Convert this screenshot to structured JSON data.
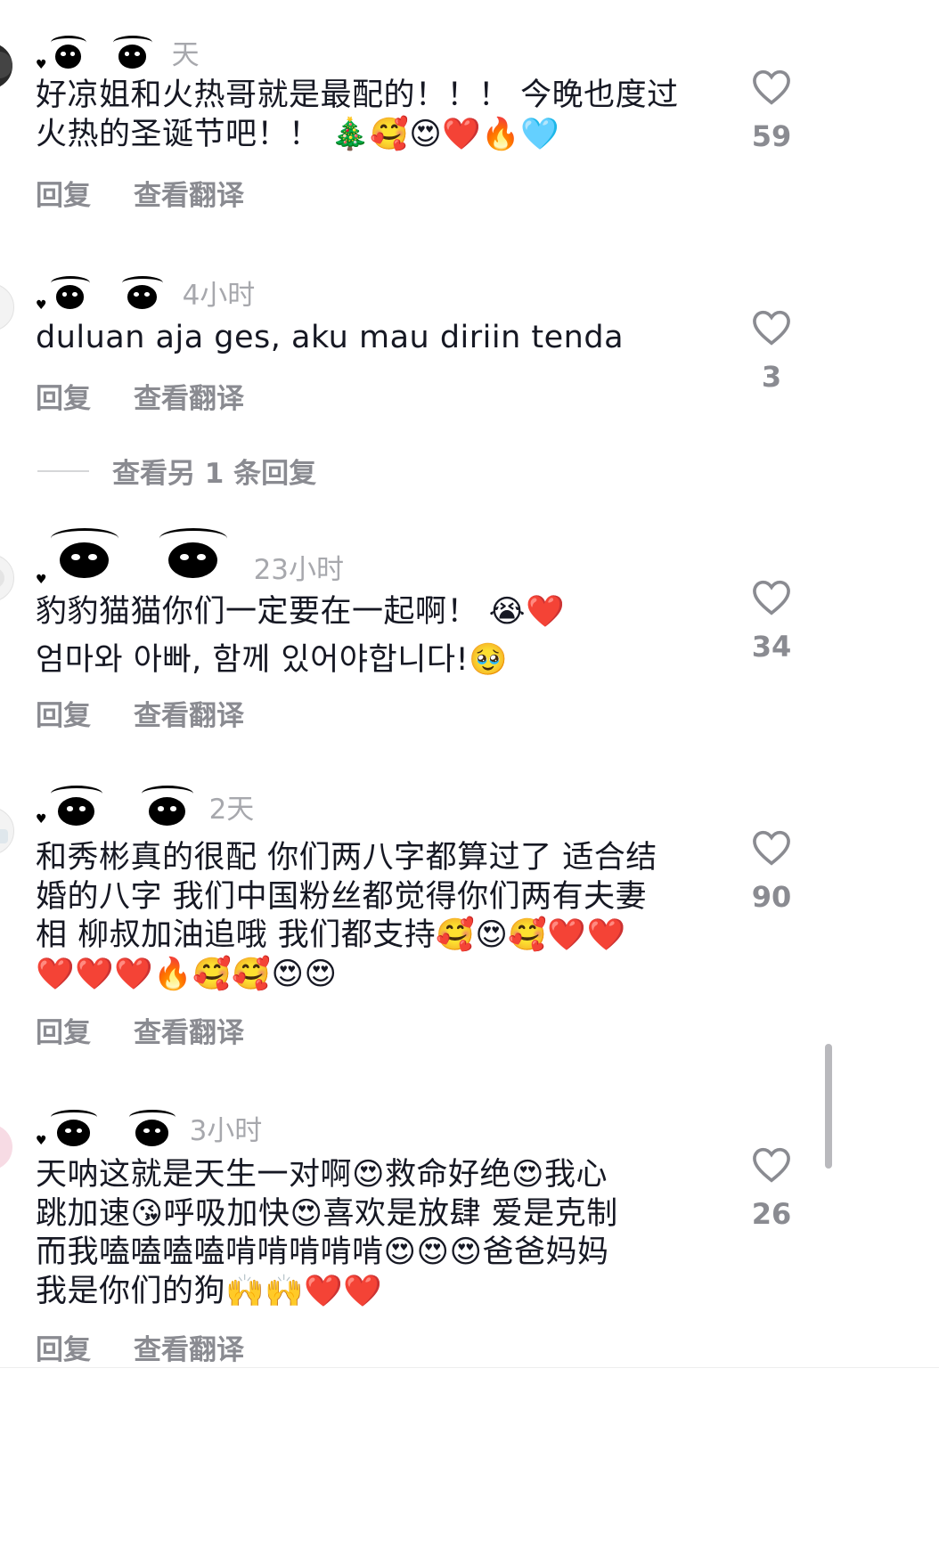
{
  "comments": [
    {
      "time": "天",
      "text": "好凉姐和火热哥就是最配的！！！ 今晚也度过\n火热的圣诞节吧！！ 🎄🥰😍❤️🔥🩵",
      "likes": "59",
      "reply_label": "回复",
      "translate_label": "查看翻译"
    },
    {
      "time": "4小时",
      "text": "duluan aja ges, aku mau diriin tenda",
      "likes": "3",
      "reply_label": "回复",
      "translate_label": "查看翻译"
    },
    {
      "time": "23小时",
      "text": "豹豹猫猫你们一定要在一起啊！ 😭❤️\n엄마와 아빠, 함께 있어야합니다!🥹",
      "likes": "34",
      "reply_label": "回复",
      "translate_label": "查看翻译"
    },
    {
      "time": "2天",
      "text": "和秀彬真的很配 你们两八字都算过了 适合结\n婚的八字 我们中国粉丝都觉得你们两有夫妻\n相 柳叔加油追哦 我们都支持🥰😍🥰❤️❤️\n❤️❤️❤️🔥🥰🥰😍😍",
      "likes": "90",
      "reply_label": "回复",
      "translate_label": "查看翻译"
    },
    {
      "time": "3小时",
      "text": "天呐这就是天生一对啊😍救命好绝😍我心\n跳加速😘呼吸加快😍喜欢是放肆 爱是克制\n而我嗑嗑嗑嗑啃啃啃啃啃😍😍😍爸爸妈妈\n我是你们的狗🙌🙌❤️❤️",
      "likes": "26",
      "reply_label": "回复",
      "translate_label": "查看翻译"
    }
  ],
  "more_replies_label": "查看另 1 条回复",
  "icons": {
    "like": "heart-outline-icon",
    "username": "eyes-emoji-icon"
  },
  "colors": {
    "text": "#161823",
    "secondary": "#8a8b91",
    "time": "#a7a8ad"
  }
}
